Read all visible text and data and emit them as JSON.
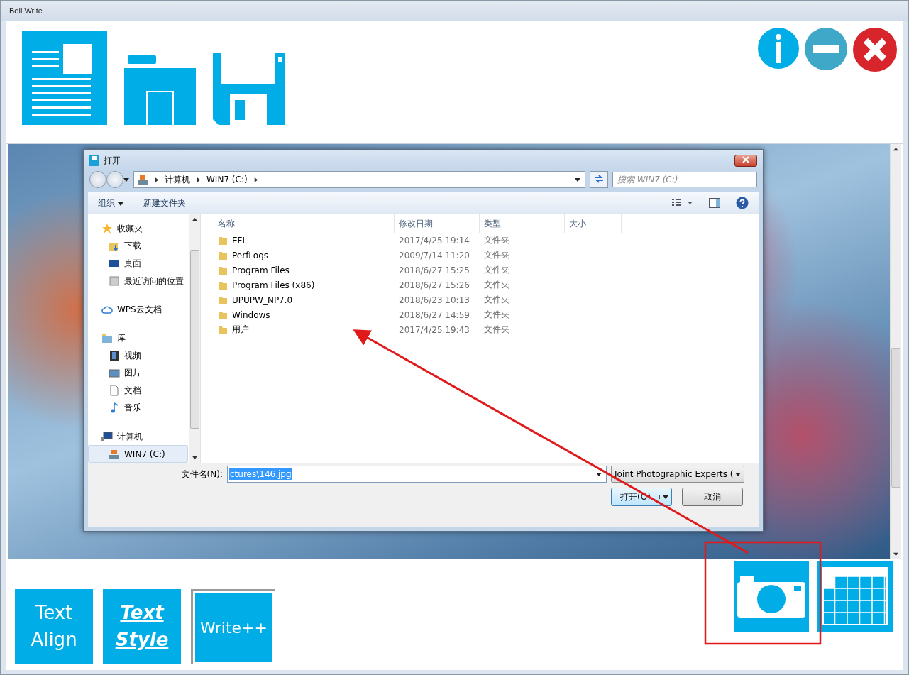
{
  "window": {
    "title": "Bell Write"
  },
  "dialog": {
    "title": "打开",
    "breadcrumb": [
      "计算机",
      "WIN7 (C:)"
    ],
    "search": {
      "placeholder": "搜索 WIN7 (C:)"
    },
    "commands": [
      {
        "label": "组织",
        "kind": "menu"
      },
      {
        "label": "新建文件夹",
        "kind": "plain"
      }
    ],
    "nav": [
      {
        "label": "收藏夹",
        "kind": "star",
        "selected": false,
        "children": [
          {
            "label": "下载",
            "kind": "download",
            "selected": false
          },
          {
            "label": "桌面",
            "kind": "desktop",
            "selected": false
          },
          {
            "label": "最近访问的位置",
            "kind": "recent",
            "selected": false
          }
        ]
      },
      {
        "label": "WPS云文档",
        "kind": "cloud",
        "selected": false
      },
      {
        "label": "库",
        "kind": "library",
        "selected": false,
        "children": [
          {
            "label": "视频",
            "kind": "video",
            "selected": false
          },
          {
            "label": "图片",
            "kind": "picture",
            "selected": false
          },
          {
            "label": "文档",
            "kind": "document",
            "selected": false
          },
          {
            "label": "音乐",
            "kind": "music",
            "selected": false
          }
        ]
      },
      {
        "label": "计算机",
        "kind": "computer",
        "selected": false,
        "children": [
          {
            "label": "WIN7 (C:)",
            "kind": "drive",
            "selected": true
          }
        ]
      }
    ],
    "columns": [
      "名称",
      "修改日期",
      "类型",
      "大小"
    ],
    "rows": [
      {
        "name": "EFI",
        "modified": "2017/4/25 19:14",
        "type": "文件夹"
      },
      {
        "name": "PerfLogs",
        "modified": "2009/7/14 11:20",
        "type": "文件夹"
      },
      {
        "name": "Program Files",
        "modified": "2018/6/27 15:25",
        "type": "文件夹"
      },
      {
        "name": "Program Files (x86)",
        "modified": "2018/6/27 15:26",
        "type": "文件夹"
      },
      {
        "name": "UPUPW_NP7.0",
        "modified": "2018/6/23 10:13",
        "type": "文件夹"
      },
      {
        "name": "Windows",
        "modified": "2018/6/27 14:59",
        "type": "文件夹"
      },
      {
        "name": "用户",
        "modified": "2017/4/25 19:43",
        "type": "文件夹"
      }
    ],
    "filename_label": "文件名(N):",
    "filename": "ctures\\146.jpg",
    "filter": "Joint Photographic Experts (",
    "open_button": "打开(O)",
    "cancel_button": "取消"
  },
  "bottom_buttons": [
    {
      "label": "Text Align",
      "kind": "plain"
    },
    {
      "label": "Text Style",
      "kind": "styled"
    },
    {
      "label": "Write++",
      "kind": "framed"
    }
  ]
}
